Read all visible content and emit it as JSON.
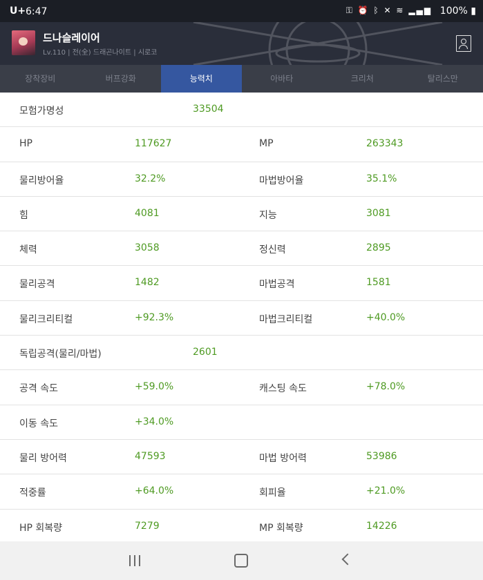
{
  "status_bar": {
    "carrier": "U+",
    "time": "6:47",
    "icons": [
      "key-icon",
      "alarm-icon",
      "bluetooth-icon",
      "mute-icon",
      "wifi-icon",
      "signal-icon"
    ],
    "battery": "100%"
  },
  "header": {
    "character_name": "드나슬레이어",
    "character_info": "Lv.110 | 전(全) 드래곤나이트 | 시로코"
  },
  "tabs": [
    {
      "label": "장착장비",
      "active": false
    },
    {
      "label": "버프강화",
      "active": false
    },
    {
      "label": "능력치",
      "active": true
    },
    {
      "label": "아바타",
      "active": false
    },
    {
      "label": "크리처",
      "active": false
    },
    {
      "label": "탈리스만",
      "active": false
    }
  ],
  "stats": [
    {
      "label": "모험가명성",
      "value": "33504"
    },
    {
      "label": "HP",
      "value": "117627",
      "label2": "MP",
      "value2": "263343"
    },
    {
      "label": "물리방어율",
      "value": "32.2%",
      "label2": "마법방어율",
      "value2": "35.1%"
    },
    {
      "label": "힘",
      "value": "4081",
      "label2": "지능",
      "value2": "3081"
    },
    {
      "label": "체력",
      "value": "3058",
      "label2": "정신력",
      "value2": "2895"
    },
    {
      "label": "물리공격",
      "value": "1482",
      "label2": "마법공격",
      "value2": "1581"
    },
    {
      "label": "물리크리티컬",
      "value": "+92.3%",
      "label2": "마법크리티컬",
      "value2": "+40.0%"
    },
    {
      "label": "독립공격(물리/마법)",
      "value": "2601"
    },
    {
      "label": "공격 속도",
      "value": "+59.0%",
      "label2": "캐스팅 속도",
      "value2": "+78.0%"
    },
    {
      "label": "이동 속도",
      "value": "+34.0%",
      "label2": "",
      "value2": ""
    },
    {
      "label": "물리 방어력",
      "value": "47593",
      "label2": "마법 방어력",
      "value2": "53986"
    },
    {
      "label": "적중률",
      "value": "+64.0%",
      "label2": "회피율",
      "value2": "+21.0%"
    },
    {
      "label": "HP 회복량",
      "value": "7279",
      "label2": "MP 회복량",
      "value2": "14226"
    }
  ],
  "colors": {
    "value_green": "#4e9a22",
    "active_tab": "#3557a0",
    "header_bg": "#2a2e3a"
  }
}
